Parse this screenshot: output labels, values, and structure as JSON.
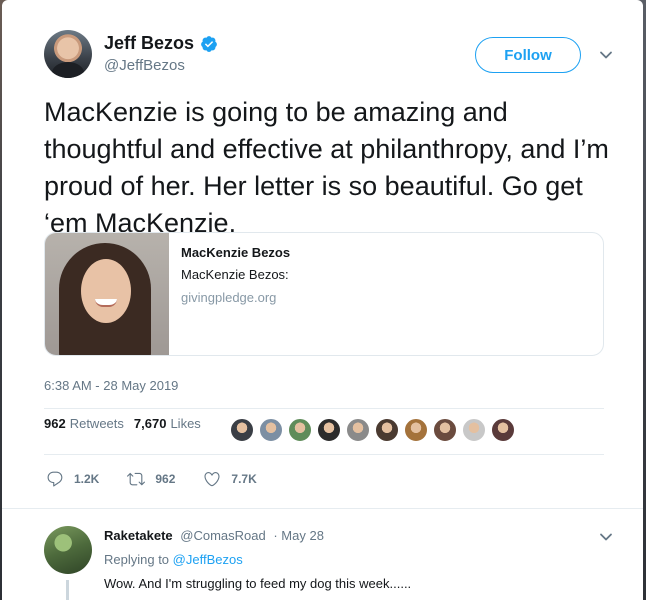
{
  "tweet": {
    "author": {
      "display_name": "Jeff Bezos",
      "handle": "@JeffBezos",
      "verified": true
    },
    "follow_label": "Follow",
    "text": "MacKenzie is going to be amazing and thoughtful and effective at philanthropy, and I’m proud of her. Her letter is so beautiful. Go get ‘em MacKenzie.",
    "link_card": {
      "title": "MacKenzie Bezos",
      "description": "MacKenzie Bezos:",
      "domain": "givingpledge.org"
    },
    "timestamp": "6:38 AM - 28 May 2019",
    "stats": {
      "retweets_count": "962",
      "retweets_label": "Retweets",
      "likes_count": "7,670",
      "likes_label": "Likes"
    },
    "liker_faces": [
      "#3a3e45",
      "#7c8fa3",
      "#5f8c5a",
      "#2b2b2b",
      "#8a8a8a",
      "#4a3a30",
      "#a4723b",
      "#6b4b3e",
      "#c8c8c8",
      "#5a3a3a"
    ],
    "actions": {
      "reply_count": "1.2K",
      "retweet_count": "962",
      "like_count": "7.7K"
    }
  },
  "reply": {
    "name": "Raketakete",
    "handle": "@ComasRoad",
    "date": "· May 28",
    "replying_to_prefix": "Replying to",
    "replying_to_handle": "@JeffBezos",
    "text": "Wow. And I'm struggling to feed my dog this week......"
  },
  "colors": {
    "accent": "#1da1f2",
    "secondary_text": "#657786"
  }
}
